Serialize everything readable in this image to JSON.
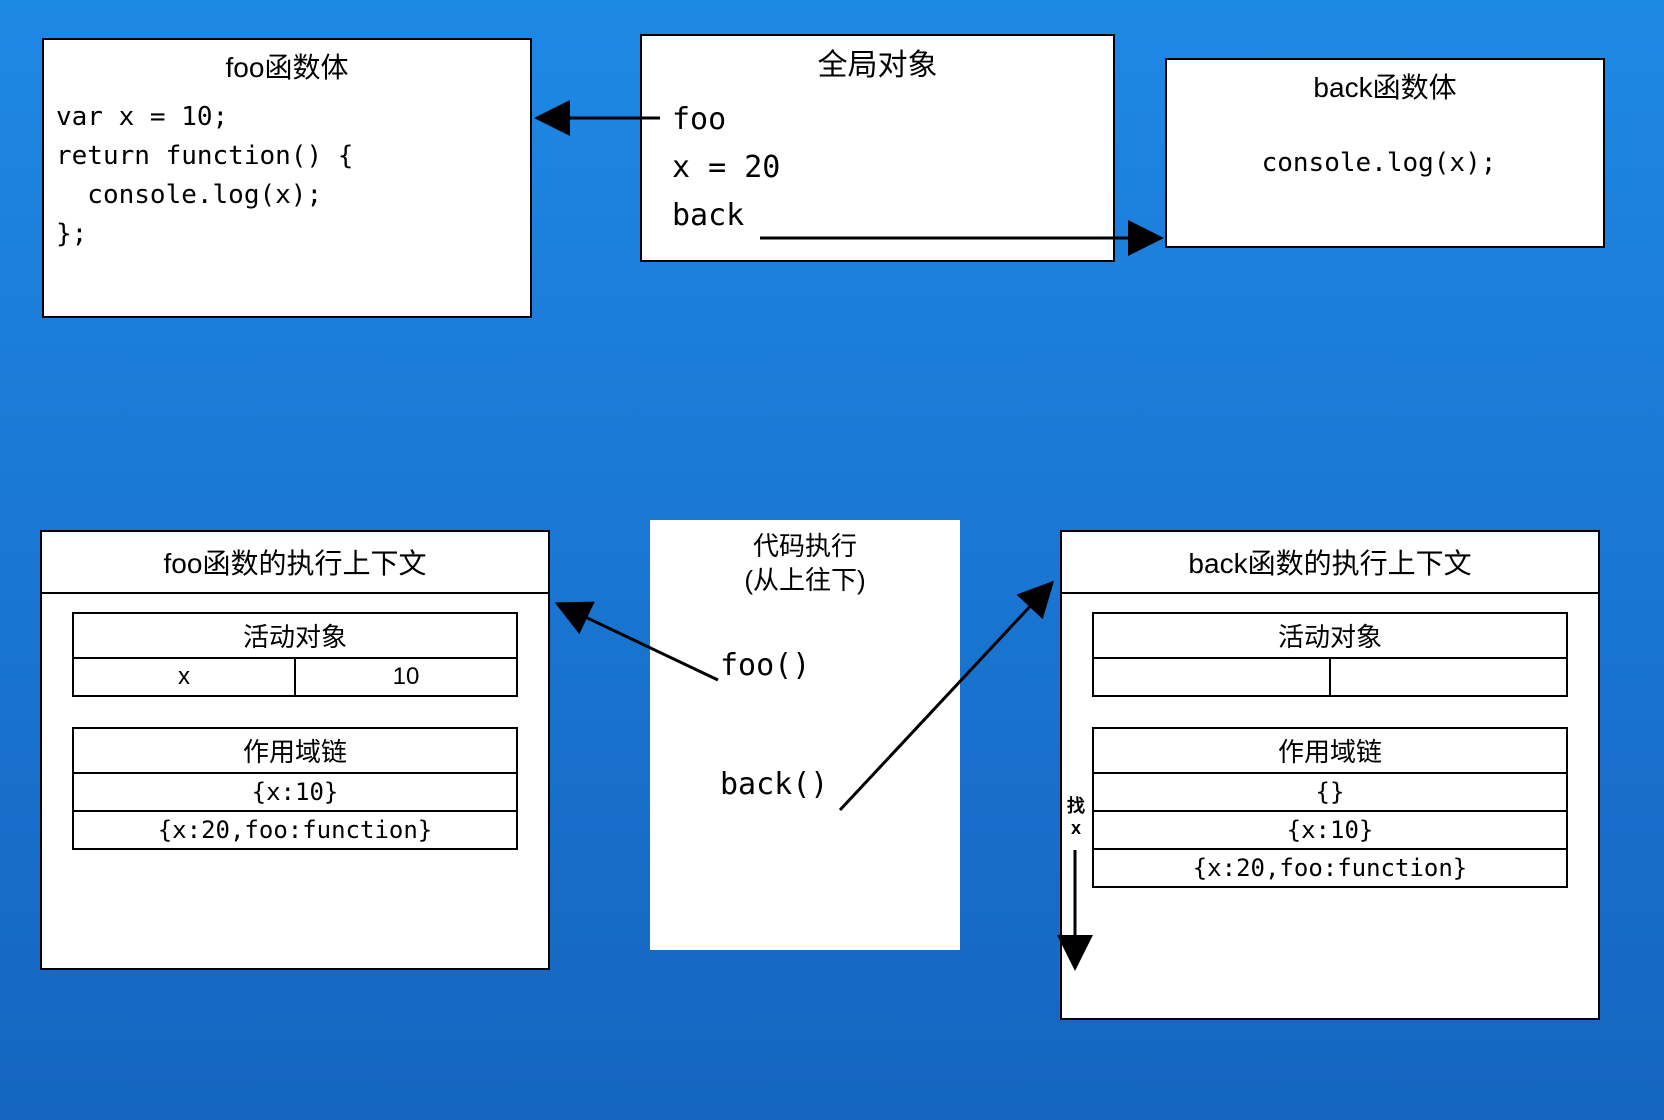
{
  "foo_body": {
    "title": "foo函数体",
    "code": "var x = 10;\nreturn function() {\n  console.log(x);\n};"
  },
  "global_obj": {
    "title": "全局对象",
    "line1": "foo",
    "line2": "x = 20",
    "line3": "back"
  },
  "back_body": {
    "title": "back函数体",
    "code": "console.log(x);"
  },
  "foo_ctx": {
    "title": "foo函数的执行上下文",
    "ao_title": "活动对象",
    "ao_key": "x",
    "ao_val": "10",
    "scope_title": "作用域链",
    "scope1": "{x:10}",
    "scope2": "{x:20,foo:function}"
  },
  "code_exec": {
    "title1": "代码执行",
    "title2": "(从上往下)",
    "call1": "foo()",
    "call2": "back()"
  },
  "back_ctx": {
    "title": "back函数的执行上下文",
    "ao_title": "活动对象",
    "scope_title": "作用域链",
    "scope1": "{}",
    "scope2": "{x:10}",
    "scope3": "{x:20,foo:function}"
  },
  "find_x": "找\nx"
}
